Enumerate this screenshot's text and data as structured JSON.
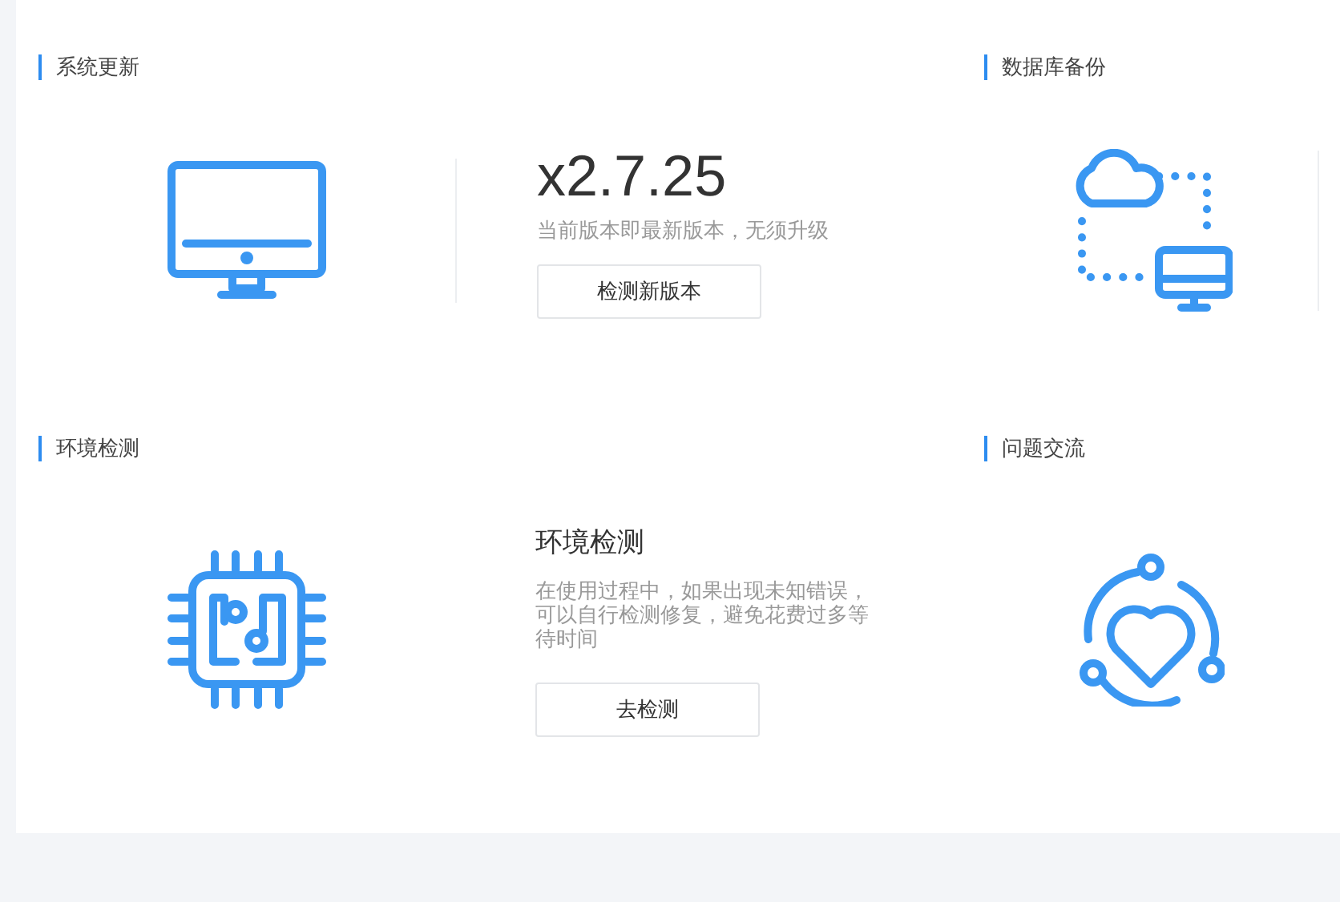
{
  "sections": [
    {
      "kind": "update",
      "title": "系统更新",
      "heading": "x2.7.25",
      "description": "当前版本即最新版本，无须升级",
      "button": "检测新版本"
    },
    {
      "kind": "backup",
      "title": "数据库备份"
    },
    {
      "kind": "environment",
      "title": "环境检测",
      "heading": "环境检测",
      "description": "在使用过程中，如果出现未知错误，可以自行检测修复，避免花费过多等待时间",
      "button": "去检测"
    },
    {
      "kind": "community",
      "title": "问题交流"
    }
  ]
}
